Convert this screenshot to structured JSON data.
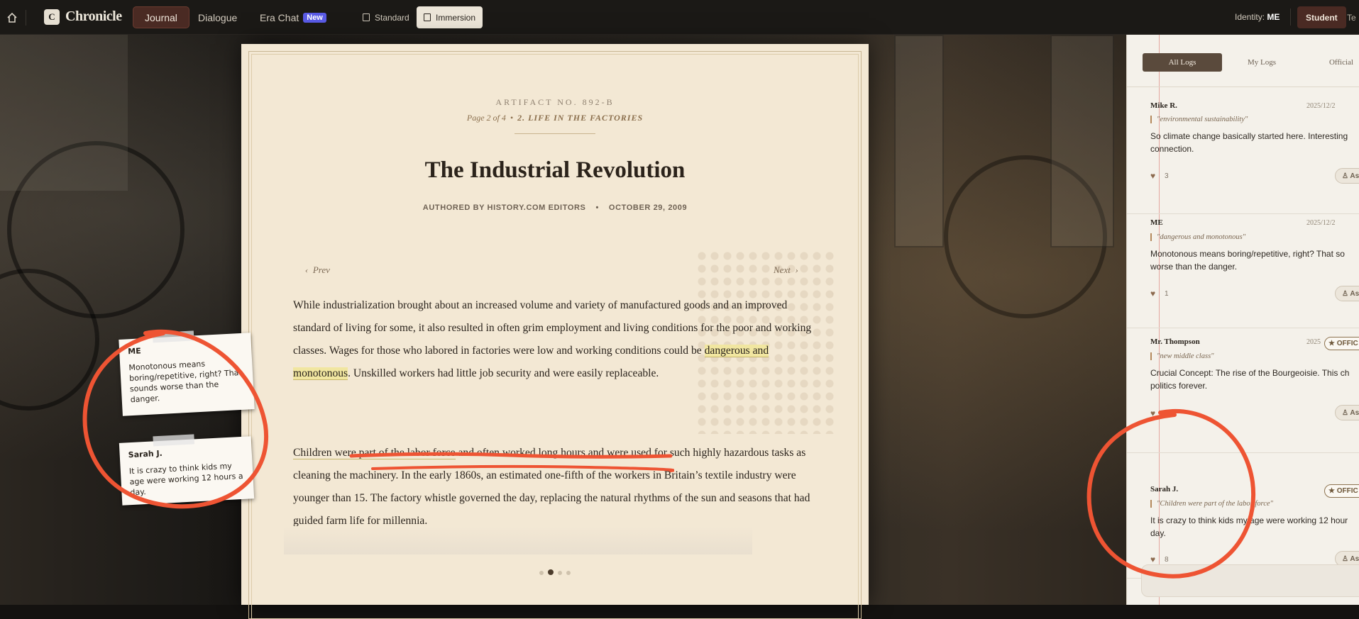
{
  "topbar": {
    "app_name": "Chronicle",
    "logo_letter": "C",
    "tabs": [
      {
        "label": "Journal",
        "active": true
      },
      {
        "label": "Dialogue",
        "active": false
      },
      {
        "label": "Era Chat",
        "badge": "New",
        "active": false
      }
    ],
    "view_modes": [
      {
        "label": "Standard",
        "active": false
      },
      {
        "label": "Immersion",
        "active": true
      }
    ],
    "identity_label": "Identity:",
    "identity_value": "ME",
    "roles": [
      {
        "label": "Student",
        "active": true
      },
      {
        "label": "Te",
        "active": false
      }
    ]
  },
  "article": {
    "artifact": "ARTIFACT NO. 892-B",
    "page_info": "Page 2 of 4",
    "section": "2. LIFE IN THE FACTORIES",
    "title": "The Industrial Revolution",
    "author": "AUTHORED BY HISTORY.COM EDITORS",
    "date": "OCTOBER 29, 2009",
    "prev_label": "Prev",
    "next_label": "Next",
    "p1_a": "While industrialization brought about an increased volume and variety of manufactured goods and an improved standard of living for some, it also resulted in often grim employment and living conditions for the poor and working classes. Wages for those who labored in factories were low and working conditions could be ",
    "p1_highlight": "dangerous and monotonous",
    "p1_b": ".  Unskilled workers had little job security and were easily replaceable.",
    "p2_highlight": "Children were part of the labor force",
    "p2_b": " and often worked long hours and were used for such highly hazardous tasks as cleaning the machinery. In the early 1860s, an estimated one-fifth of the workers in Britain’s textile industry were younger than 15. The factory whistle governed the day, replacing the natural rhythms of the sun and seasons that had guided farm life for millennia.",
    "pages": 4,
    "current_page_dot": 2
  },
  "sticky_notes": [
    {
      "who": "ME",
      "text": "Monotonous means boring/repetitive, right? That sounds worse than the danger."
    },
    {
      "who": "Sarah J.",
      "text": "It is crazy to think kids my age were working 12 hours a day."
    }
  ],
  "sidebar": {
    "filters": [
      {
        "label": "All Logs",
        "active": true
      },
      {
        "label": "My Logs",
        "active": false
      },
      {
        "label": "Official",
        "active": false
      }
    ],
    "logs": [
      {
        "who": "Mike R.",
        "date": "2025/12/2",
        "quote": "\"environmental sustainability\"",
        "text": "So climate change basically started here. Interesting connection.",
        "likes": "3",
        "ask": "As",
        "official": false
      },
      {
        "who": "ME",
        "date": "2025/12/2",
        "quote": "\"dangerous and monotonous\"",
        "text": "Monotonous means boring/repetitive, right? That so worse than the danger.",
        "likes": "1",
        "ask": "As",
        "official": false
      },
      {
        "who": "Mr. Thompson",
        "date": "2025",
        "quote": "\"new middle class\"",
        "text": "Crucial Concept: The rise of the Bourgeoisie. This ch politics forever.",
        "likes": "12",
        "ask": "As",
        "official": true,
        "official_label": "OFFIC"
      },
      {
        "who": "Sarah J.",
        "date": "",
        "quote": "\"Children were part of the labor force\"",
        "text": "It is crazy to think kids my age were working 12 hour day.",
        "likes": "8",
        "ask": "As",
        "official": true,
        "official_label": "OFFIC"
      }
    ]
  },
  "colors": {
    "accent_tab": "#4a2a23",
    "annotation_red": "#ee5433",
    "paper": "#f3e8d4",
    "highlight": "#f1e6a0"
  }
}
